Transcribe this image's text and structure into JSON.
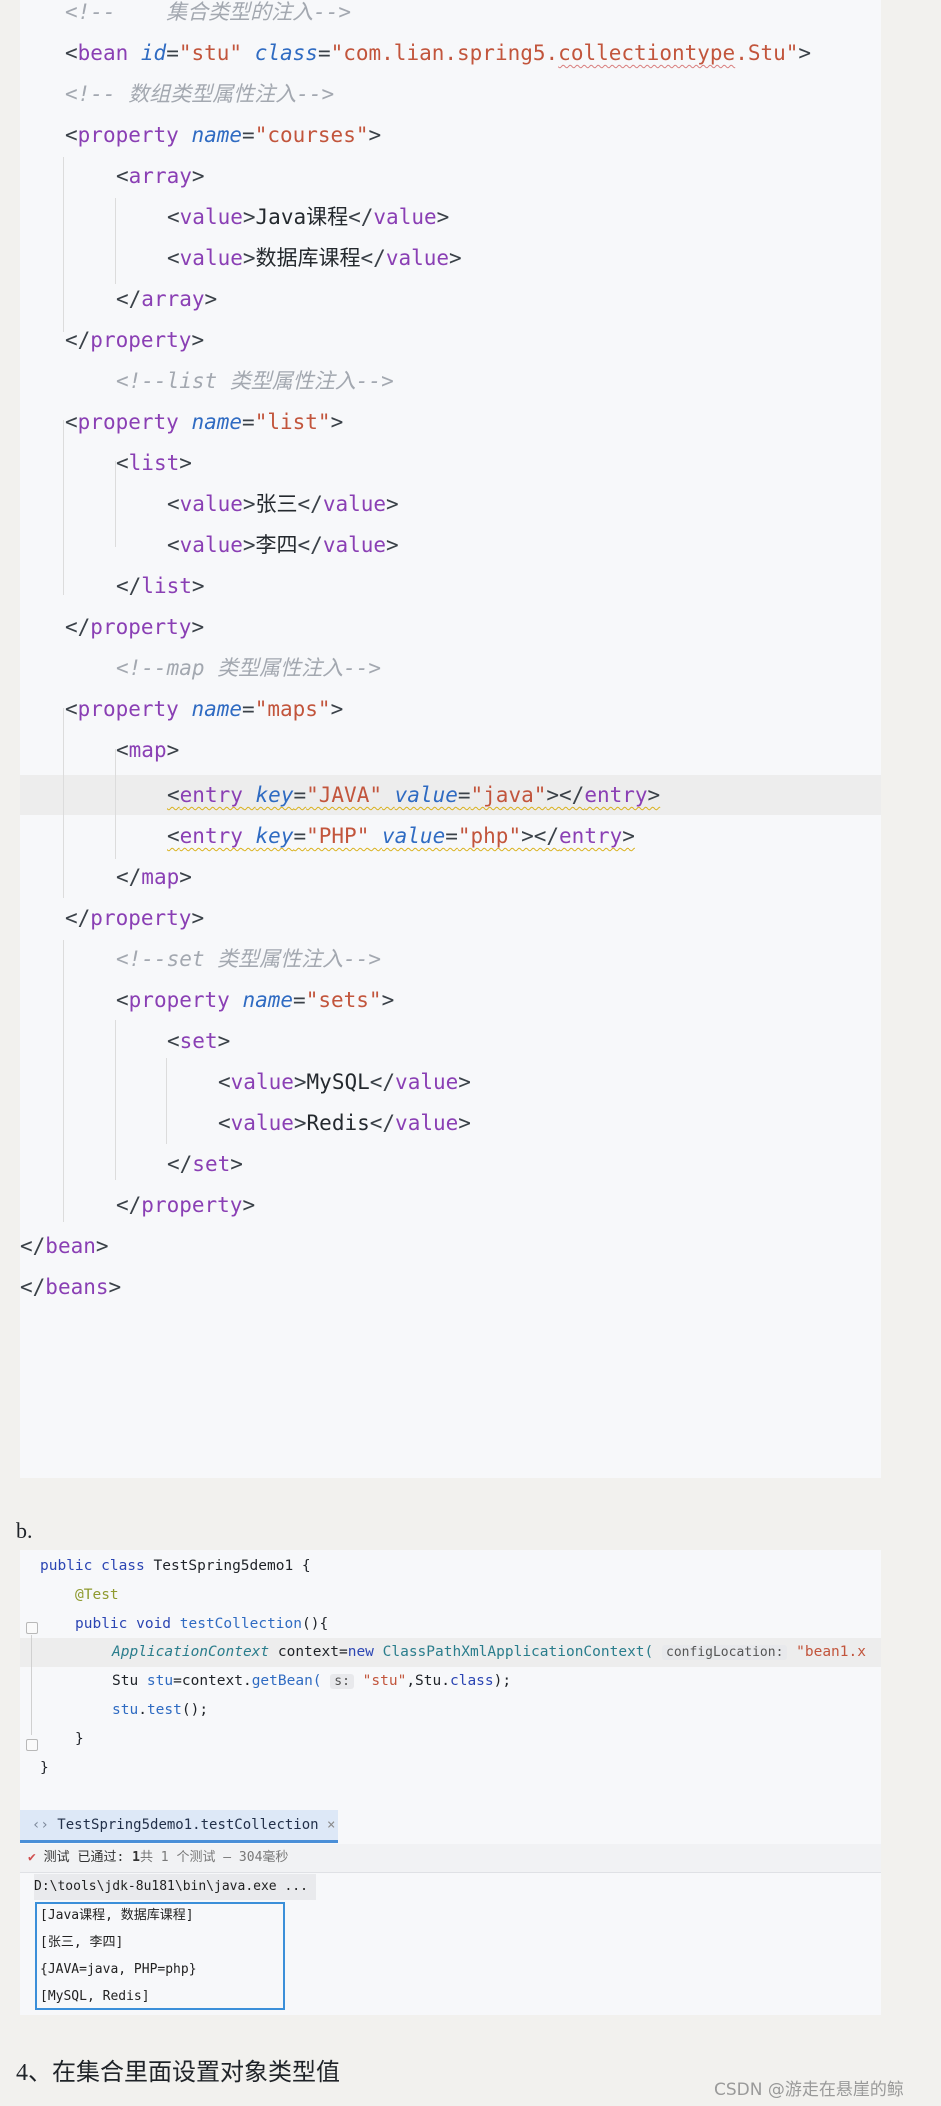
{
  "xml": {
    "comment_collection": "<!--    集合类型的注入-->",
    "bean_open": {
      "tag": "bean",
      "id_attr": "id",
      "id_val": "\"stu\"",
      "class_attr": "class",
      "class_val_pre": "\"com.lian.spring5.",
      "class_val_err": "collectiontype",
      "class_val_post": ".Stu\""
    },
    "comment_array": "<!-- 数组类型属性注入-->",
    "prop_courses": {
      "tag": "property",
      "attr": "name",
      "val": "\"courses\""
    },
    "array_tag": "array",
    "array_values": [
      "Java课程",
      "数据库课程"
    ],
    "value_tag": "value",
    "prop_close": "property",
    "comment_list": "<!--list 类型属性注入-->",
    "prop_list": {
      "tag": "property",
      "attr": "name",
      "val": "\"list\""
    },
    "list_tag": "list",
    "list_values": [
      "张三",
      "李四"
    ],
    "comment_map": "<!--map 类型属性注入-->",
    "prop_maps": {
      "tag": "property",
      "attr": "name",
      "val": "\"maps\""
    },
    "map_tag": "map",
    "entry_tag": "entry",
    "entry_key_attr": "key",
    "entry_value_attr": "value",
    "entries": [
      {
        "key": "\"JAVA\"",
        "value": "\"java\""
      },
      {
        "key": "\"PHP\"",
        "value": "\"php\""
      }
    ],
    "comment_set": "<!--set 类型属性注入-->",
    "prop_sets": {
      "tag": "property",
      "attr": "name",
      "val": "\"sets\""
    },
    "set_tag": "set",
    "set_values": [
      "MySQL",
      "Redis"
    ],
    "bean_close": "bean",
    "beans_close": "beans"
  },
  "label_b": "b.",
  "java": {
    "l1_kw": "public class ",
    "l1_name": "TestSpring5demo1 {",
    "l2": "@Test",
    "l3_kw": "public void ",
    "l3_fn": "testCollection",
    "l3_rest": "(){",
    "l4_type": "ApplicationContext",
    "l4_var": " context=",
    "l4_new": "new ",
    "l4_cls": "ClassPathXmlApplicationContext(",
    "l4_hint": "configLocation:",
    "l4_str": " \"bean1.x",
    "l5_type": "Stu ",
    "l5_var": "stu",
    "l5_eq": "=context.",
    "l5_fn": "getBean(",
    "l5_hint": "s:",
    "l5_str": " \"stu\"",
    "l5_rest": ",Stu.",
    "l5_kw": "class",
    "l5_end": ");",
    "l6_var": "stu",
    "l6_rest": ".",
    "l6_fn": "test",
    "l6_end": "();",
    "l7": "}",
    "l8": "}"
  },
  "runner": {
    "tab_label": "TestSpring5demo1.testCollection",
    "close_icon": "×",
    "status_pass": "测试 已通过: ",
    "status_count": "1",
    "status_rest": "共 1 个测试 – 304毫秒",
    "console_path": "D:\\tools\\jdk-8u181\\bin\\java.exe ...",
    "outputs": [
      "[Java课程, 数据库课程]",
      "[张三, 李四]",
      "{JAVA=java, PHP=php}",
      "[MySQL, Redis]"
    ]
  },
  "footer": {
    "heading": "4、在集合里面设置对象类型值",
    "watermark": "CSDN @游走在悬崖的鲸"
  },
  "colors": {
    "tag_name": "#8a3fb4",
    "attr": "#2f6bc2",
    "attr_value": "#c2553c",
    "comment": "#a3a8b0",
    "check": "#d05050"
  }
}
